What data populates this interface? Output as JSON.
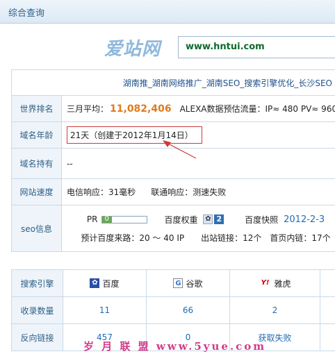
{
  "header": {
    "title": "综合查询"
  },
  "logo": {
    "text": "爱站网"
  },
  "search": {
    "url": "www.hntui.com"
  },
  "site_title": "湖南推_湖南网络推广_湖南SEO_搜索引擎优化_长沙SEO",
  "rows": {
    "rank": {
      "label": "世界排名",
      "avg_label": "三月平均：",
      "avg_value": "11,082,406",
      "alexa": "ALEXA数据预估流量：IP≈ 480 PV≈ 960"
    },
    "age": {
      "label": "域名年龄",
      "value": "21天（创建于2012年1月14日）"
    },
    "owner": {
      "label": "域名持有",
      "value": "--"
    },
    "speed": {
      "label": "网站速度",
      "telecom": "电信响应：31毫秒",
      "unicom": "联通响应：测速失败"
    },
    "seo": {
      "label": "seo信息",
      "pr_label": "PR",
      "pr_value": "0",
      "pr_level": 0.0,
      "baidu_weight_label": "百度权重",
      "baidu_weight_icon": "baidu-paw-icon",
      "baidu_weight_value": "2",
      "snapshot_label": "百度快照",
      "snapshot_date": "2012-2-3",
      "line2": "预计百度来路：20 ～ 40 IP　　出站链接：12个　首页内链：17个"
    }
  },
  "engines": {
    "header_label": "搜索引擎",
    "names": [
      "百度",
      "谷歌",
      "雅虎"
    ],
    "icons": [
      "baidu-icon",
      "google-icon",
      "yahoo-icon"
    ],
    "icon_glyphs": [
      "✿",
      "G",
      "Y!"
    ],
    "indexed_label": "收录数量",
    "indexed": [
      "11",
      "66",
      "2"
    ],
    "backlinks_label": "反向链接",
    "backlinks": [
      "457",
      "0",
      "获取失败"
    ]
  },
  "watermark": "岁 月 联 盟  www.5yue.com",
  "colors": {
    "accent": "#2d5f86",
    "rank": "#e07a1c",
    "highlight_box": "#c93b3b",
    "link": "#1e6bb8"
  }
}
